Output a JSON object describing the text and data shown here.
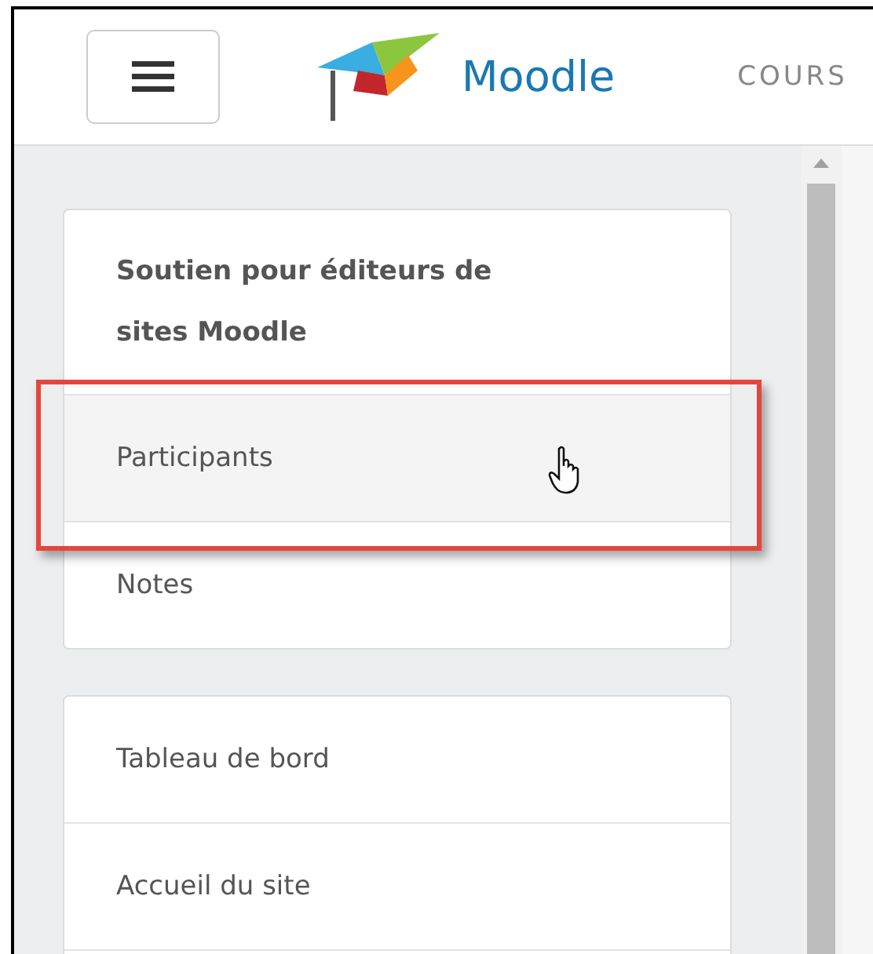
{
  "header": {
    "brand": "Moodle",
    "nav_item": "COURS"
  },
  "sidebar": {
    "cards": [
      {
        "items": [
          {
            "kind": "heading",
            "label": "Soutien pour éditeurs de sites Moodle",
            "hovered": false,
            "highlighted": false
          },
          {
            "kind": "link",
            "label": "Participants",
            "hovered": true,
            "highlighted": true
          },
          {
            "kind": "link",
            "label": "Notes",
            "hovered": false,
            "highlighted": false
          }
        ]
      },
      {
        "items": [
          {
            "kind": "link",
            "label": "Tableau de bord",
            "hovered": false,
            "highlighted": false
          },
          {
            "kind": "link",
            "label": "Accueil du site",
            "hovered": false,
            "highlighted": false
          },
          {
            "kind": "empty"
          }
        ]
      }
    ]
  }
}
